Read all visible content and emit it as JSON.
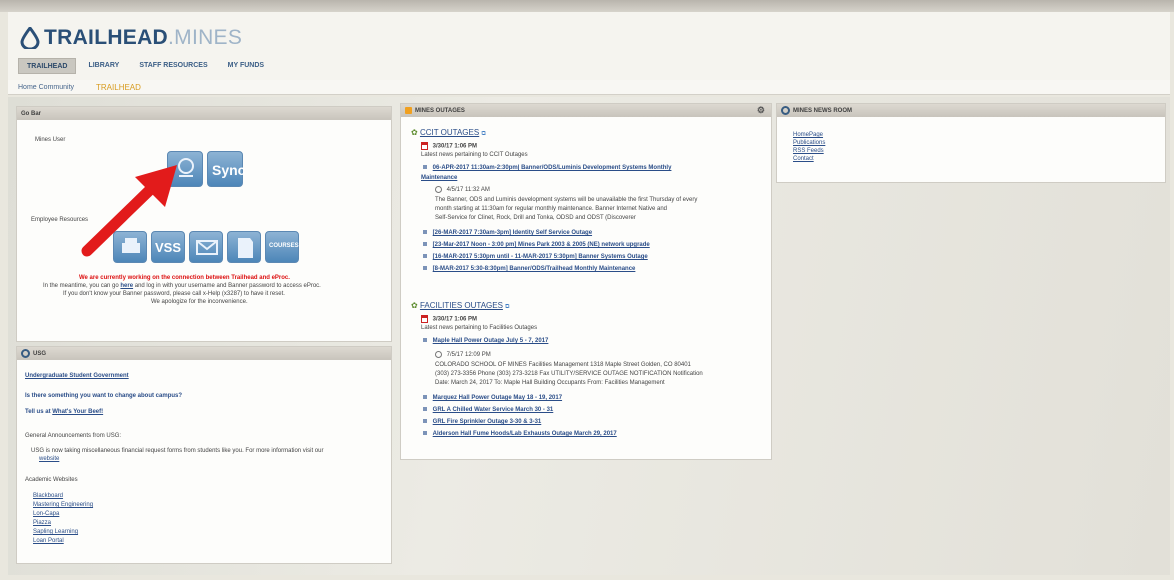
{
  "header": {
    "logo_word_1": "TRAILHEAD",
    "logo_word_2": ".MINES",
    "tabs": [
      {
        "label": "TRAILHEAD",
        "active": true
      },
      {
        "label": "LIBRARY"
      },
      {
        "label": "STAFF RESOURCES"
      },
      {
        "label": "MY FUNDS"
      }
    ]
  },
  "subnav": {
    "items": [
      {
        "label": "Home Community"
      },
      {
        "label": "TRAILHEAD",
        "active": true
      }
    ]
  },
  "go_bar": {
    "title": "Go Bar",
    "mines_user": "Mines User",
    "employee_resources": "Employee Resources",
    "tiles": {
      "sync": "Sync",
      "vss": "VSS",
      "courses": "COURSES"
    },
    "warning": "We are currently working on the connection between Trailhead and eProc.",
    "note_line1_a": "In the meantime, you can go",
    "note_line1_link": "here",
    "note_line1_b": "and log in with your username and Banner password to access eProc.",
    "note_line2": "If you don't know your Banner password, please call x-Help (x3287) to have it reset.",
    "note_line3": "We apologize for the inconvenience."
  },
  "usg": {
    "title": "USG",
    "link_usg": "Undergraduate Student Government",
    "question": "Is there something you want to change about campus?",
    "tell_a": "Tell us at",
    "tell_link": "What's Your Beef!",
    "announcements": "General Announcements from USG:",
    "bullet_text": "USG is now taking miscellaneous financial request forms from students like you. For more information visit our",
    "bullet_link": "website",
    "academic": "Academic Websites",
    "academic_links": [
      "Blackboard",
      "Mastering Engineering",
      "Lon-Capa",
      "Piazza",
      "Sapling Learning",
      "Loan Portal"
    ]
  },
  "outages": {
    "title": "MINES OUTAGES",
    "ccit": {
      "heading": "CCIT OUTAGES",
      "date": "3/30/17 1:06 PM",
      "desc": "Latest news pertaining to CCIT Outages",
      "main_item_line1": "06-APR-2017 11:30am-2:30pm| Banner/ODS/Luminis Development Systems Monthly",
      "main_item_line2": "Maintenance",
      "main_time": "4/5/17 11:32 AM",
      "body_lines": [
        "The Banner, ODS and Luminis development systems will be unavailable the first Thursday of every",
        "month starting at 11:30am for regular monthly maintenance. Banner Internet Native and",
        "Self-Service for Clinet, Rock, Drill and Tonka, ODSD and ODST (Discoverer"
      ],
      "items": [
        "[26-MAR-2017 7:30am-3pm] Identity Self Service Outage",
        "[23-Mar-2017 Noon - 3:00 pm] Mines Park 2003 & 2005 (NE) network upgrade",
        "[16-MAR-2017 5:30pm until - 11-MAR-2017 5:30pm] Banner Systems Outage",
        "[8-MAR-2017 5:30-8:30pm] Banner/ODS/Trailhead Monthly Maintenance"
      ]
    },
    "facilities": {
      "heading": "FACILITIES OUTAGES",
      "date": "3/30/17 1:06 PM",
      "desc": "Latest news pertaining to Facilities Outages",
      "main_item": "Maple Hall Power Outage July 5 - 7, 2017",
      "main_time": "7/5/17 12:09 PM",
      "body_lines": [
        "COLORADO SCHOOL OF MINES Facilities Management 1318 Maple Street Golden, CO 80401",
        "(303) 273-3356 Phone (303) 273-3218 Fax UTILITY/SERVICE OUTAGE NOTIFICATION Notification",
        "Date: March 24, 2017 To: Maple Hall Building Occupants From: Facilities Management"
      ],
      "items": [
        "Marquez Hall Power Outage May 18 - 19, 2017",
        "GRL A Chilled Water Service March 30 - 31",
        "GRL Fire Sprinkler Outage 3-30 & 3-31",
        "Alderson Hall Fume Hoods/Lab Exhausts Outage March 29, 2017"
      ]
    }
  },
  "news": {
    "title": "MINES NEWS ROOM",
    "links": [
      "HomePage",
      "Publications",
      "RSS Feeds",
      "Contact"
    ]
  },
  "colors": {
    "brand_navy": "#2a4f77",
    "accent_orange": "#d89c20",
    "warning_red": "#d11",
    "annotation_arrow": "#e21b1b"
  }
}
